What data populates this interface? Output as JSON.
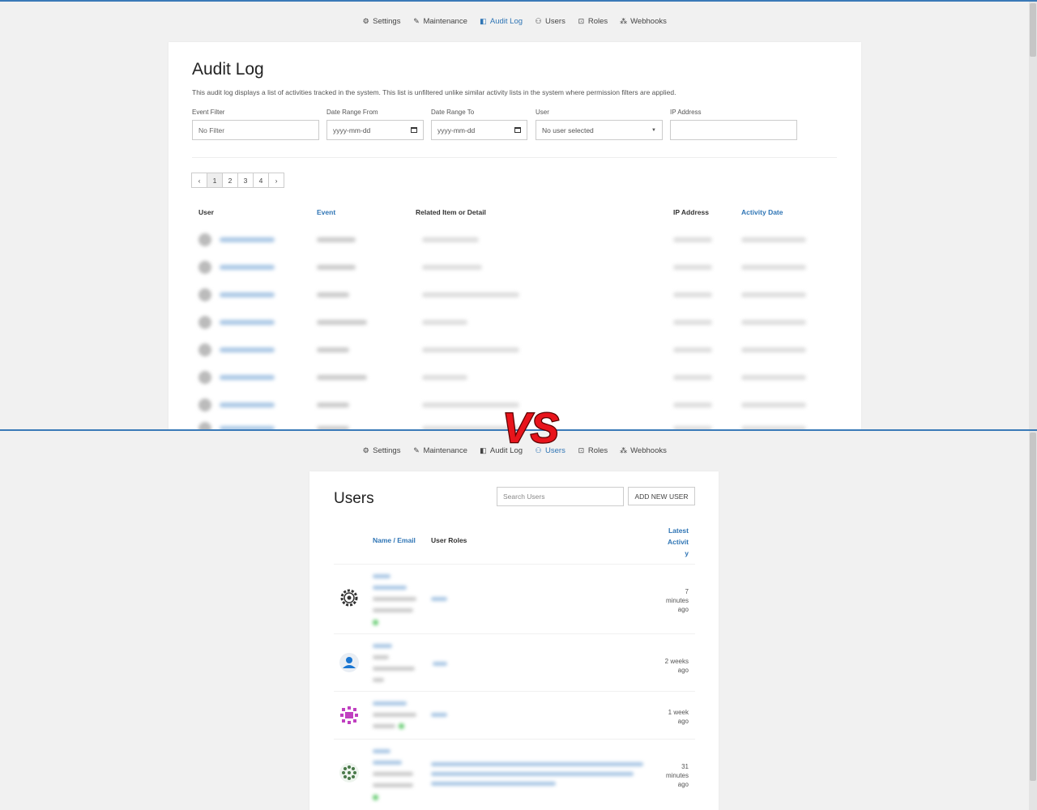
{
  "nav": [
    {
      "label": "Settings",
      "icon": "gear-icon",
      "glyph": "⚙"
    },
    {
      "label": "Maintenance",
      "icon": "wrench-icon",
      "glyph": "🔧"
    },
    {
      "label": "Audit Log",
      "icon": "book-icon",
      "glyph": "◧"
    },
    {
      "label": "Users",
      "icon": "users-icon",
      "glyph": "👥"
    },
    {
      "label": "Roles",
      "icon": "lock-icon",
      "glyph": "🔒"
    },
    {
      "label": "Webhooks",
      "icon": "webhook-icon",
      "glyph": "⁂"
    }
  ],
  "audit": {
    "title": "Audit Log",
    "description": "This audit log displays a list of activities tracked in the system. This list is unfiltered unlike similar activity lists in the system where permission filters are applied.",
    "filters": {
      "event_label": "Event Filter",
      "event_value": "No Filter",
      "from_label": "Date Range From",
      "from_placeholder": "yyyy-mm-dd",
      "to_label": "Date Range To",
      "to_placeholder": "yyyy-mm-dd",
      "user_label": "User",
      "user_value": "No user selected",
      "ip_label": "IP Address"
    },
    "pager": [
      "‹",
      "1",
      "2",
      "3",
      "4",
      "›"
    ],
    "columns": {
      "user": "User",
      "event": "Event",
      "detail": "Related Item or Detail",
      "ip": "IP Address",
      "date": "Activity Date"
    }
  },
  "users": {
    "title": "Users",
    "search_placeholder": "Search Users",
    "add_button": "ADD NEW USER",
    "columns": {
      "name": "Name / Email",
      "roles": "User Roles",
      "activity_l1": "Latest",
      "activity_l2": "Activit",
      "activity_l3": "y"
    },
    "rows": [
      {
        "time": [
          "7",
          "minutes",
          "ago"
        ]
      },
      {
        "time": [
          "2 weeks",
          "ago"
        ]
      },
      {
        "time": [
          "1 week",
          "ago"
        ]
      },
      {
        "time": [
          "31",
          "minutes",
          "ago"
        ]
      }
    ]
  },
  "vs_label": "VS",
  "colors": {
    "accent": "#2f75b5",
    "vs_red": "#e8141c"
  }
}
